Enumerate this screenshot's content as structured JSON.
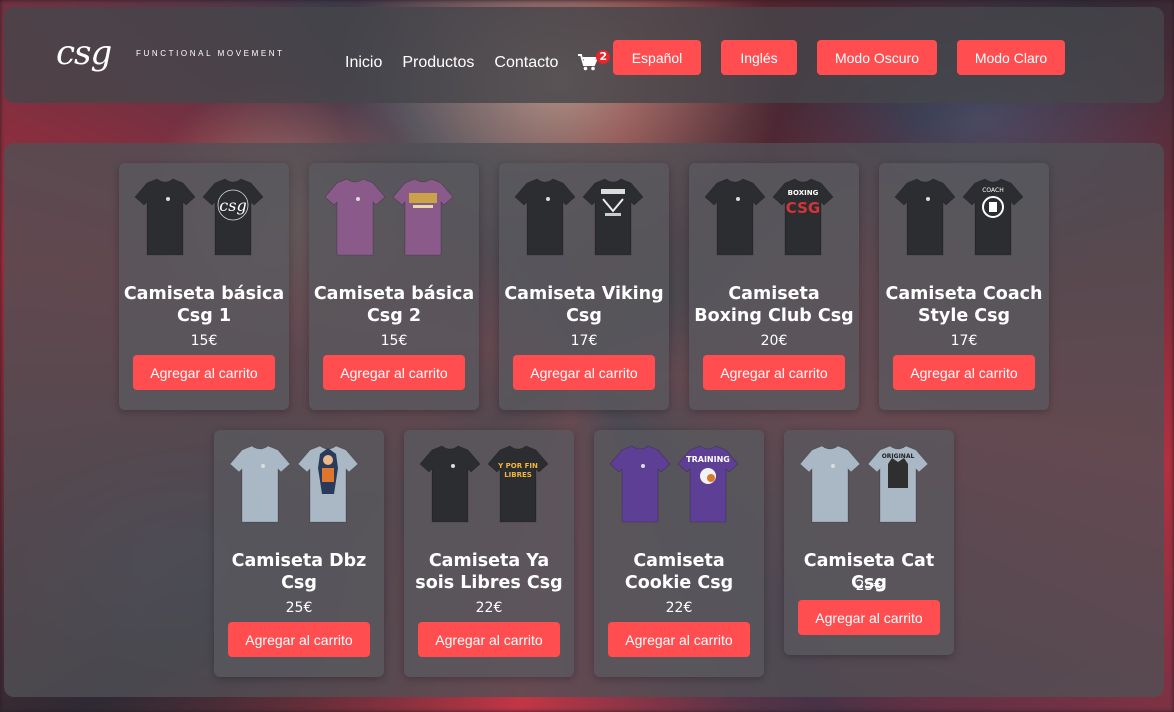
{
  "brand": {
    "logo_script": "csg",
    "tagline": "FUNCTIONAL MOVEMENT"
  },
  "nav": {
    "inicio": "Inicio",
    "productos": "Productos",
    "contacto": "Contacto"
  },
  "cart": {
    "icon": "cart-icon",
    "count": "2"
  },
  "header_buttons": {
    "espanol": "Español",
    "ingles": "Inglés",
    "oscuro": "Modo Oscuro",
    "claro": "Modo Claro"
  },
  "colors": {
    "accent": "#ff4d50",
    "badge": "#e5262b"
  },
  "products": [
    {
      "name": "Camiseta básica Csg 1",
      "price": "15€",
      "button": "Agregar al carrito",
      "front": "#2c2d31",
      "back": "#2c2d31",
      "print": "csg-script"
    },
    {
      "name": "Camiseta básica Csg 2",
      "price": "15€",
      "button": "Agregar al carrito",
      "front": "#8a5a8a",
      "back": "#8a5a8a",
      "print": "badge"
    },
    {
      "name": "Camiseta Viking Csg",
      "price": "17€",
      "button": "Agregar al carrito",
      "front": "#2c2d31",
      "back": "#2c2d31",
      "print": "viking"
    },
    {
      "name": "Camiseta Boxing Club Csg",
      "price": "20€",
      "button": "Agregar al carrito",
      "front": "#2c2d31",
      "back": "#2c2d31",
      "print": "boxing"
    },
    {
      "name": "Camiseta Coach Style Csg",
      "price": "17€",
      "button": "Agregar al carrito",
      "front": "#2c2d31",
      "back": "#2c2d31",
      "print": "coach"
    },
    {
      "name": "Camiseta Dbz Csg",
      "price": "25€",
      "button": "Agregar al carrito",
      "front": "#a9b8c4",
      "back": "#a9b8c4",
      "print": "dbz"
    },
    {
      "name": "Camiseta Ya sois Libres Csg",
      "price": "22€",
      "button": "Agregar al carrito",
      "front": "#2c2d31",
      "back": "#2c2d31",
      "print": "libres"
    },
    {
      "name": "Camiseta Cookie Csg",
      "price": "22€",
      "button": "Agregar al carrito",
      "front": "#5e3f96",
      "back": "#5e3f96",
      "print": "cookie"
    },
    {
      "name": "Camiseta Cat Csg",
      "price": "25€",
      "button": "Agregar al carrito",
      "front": "#a9b8c4",
      "back": "#a9b8c4",
      "print": "cat"
    }
  ]
}
